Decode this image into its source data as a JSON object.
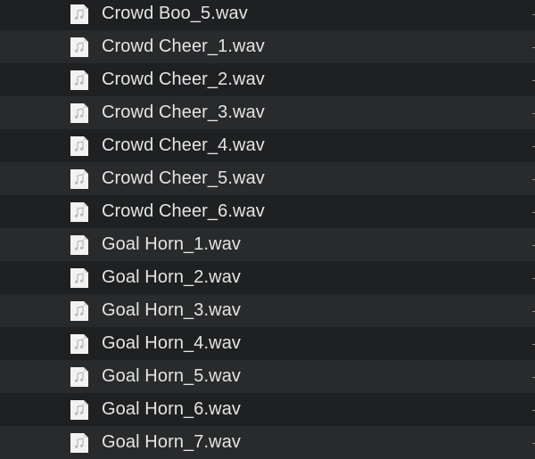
{
  "file_list": {
    "icon": "audio-file-icon",
    "items": [
      {
        "name": "Crowd Boo_5.wav"
      },
      {
        "name": "Crowd Cheer_1.wav"
      },
      {
        "name": "Crowd Cheer_2.wav"
      },
      {
        "name": "Crowd Cheer_3.wav"
      },
      {
        "name": "Crowd Cheer_4.wav"
      },
      {
        "name": "Crowd Cheer_5.wav"
      },
      {
        "name": "Crowd Cheer_6.wav"
      },
      {
        "name": "Goal Horn_1.wav"
      },
      {
        "name": "Goal Horn_2.wav"
      },
      {
        "name": "Goal Horn_3.wav"
      },
      {
        "name": "Goal Horn_4.wav"
      },
      {
        "name": "Goal Horn_5.wav"
      },
      {
        "name": "Goal Horn_6.wav"
      },
      {
        "name": "Goal Horn_7.wav"
      }
    ]
  },
  "colors": {
    "row_even": "#1e2022",
    "row_odd": "#282a2c",
    "text": "#e4e4e4",
    "icon_page": "#f2f2f2",
    "icon_glyph": "#b8b8b8"
  }
}
